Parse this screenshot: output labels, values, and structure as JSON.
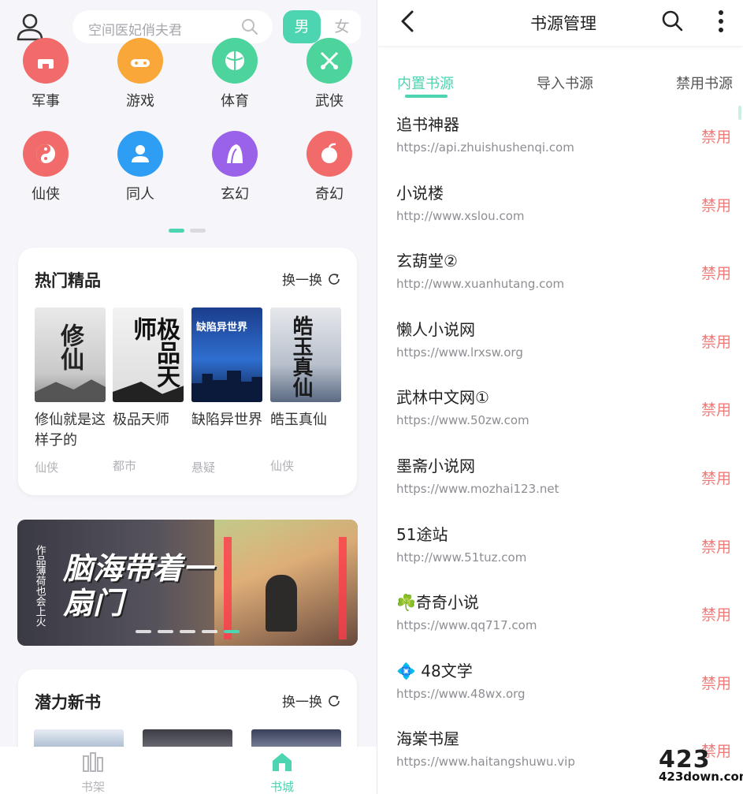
{
  "left": {
    "search": {
      "placeholder": "空间医妃俏夫君"
    },
    "gender": {
      "male": "男",
      "female": "女"
    },
    "categories_row1": [
      {
        "label": "军事",
        "color": "#f26b6b",
        "icon": "military-icon"
      },
      {
        "label": "游戏",
        "color": "#f8a738",
        "icon": "gamepad-icon"
      },
      {
        "label": "体育",
        "color": "#4dd49c",
        "icon": "basketball-icon"
      },
      {
        "label": "武侠",
        "color": "#4dd49c",
        "icon": "swords-icon"
      }
    ],
    "categories_row2": [
      {
        "label": "仙侠",
        "color": "#f26b6b",
        "icon": "taichi-icon"
      },
      {
        "label": "同人",
        "color": "#2e9ef4",
        "icon": "person-icon"
      },
      {
        "label": "玄幻",
        "color": "#9a62e8",
        "icon": "mountain-icon"
      },
      {
        "label": "奇幻",
        "color": "#f26b6b",
        "icon": "fruit-icon"
      }
    ],
    "hot": {
      "title": "热门精品",
      "refresh": "换一换",
      "books": [
        {
          "title": "修仙就是这样子的",
          "genre": "仙侠",
          "cover_text": "修仙"
        },
        {
          "title": "极品天师",
          "genre": "都市",
          "cover_text": "极品天师"
        },
        {
          "title": "缺陷异世界",
          "genre": "悬疑",
          "cover_text": "缺陷异世界"
        },
        {
          "title": "皓玉真仙",
          "genre": "仙侠",
          "cover_text": "皓玉真仙"
        }
      ]
    },
    "banner": {
      "title": "脑海带着一扇门",
      "tag": "作品",
      "author": "薄荷也会上火"
    },
    "potential": {
      "title": "潜力新书",
      "refresh": "换一换"
    },
    "nav": {
      "shelf": "书架",
      "store": "书城"
    }
  },
  "right": {
    "title": "书源管理",
    "tabs": [
      "内置书源",
      "导入书源",
      "禁用书源"
    ],
    "action_label": "禁用",
    "sources": [
      {
        "name": "追书神器",
        "url": "https://api.zhuishushenqi.com"
      },
      {
        "name": "小说楼",
        "url": "http://www.xslou.com"
      },
      {
        "name": "玄葫堂②",
        "url": "http://www.xuanhutang.com"
      },
      {
        "name": "懒人小说网",
        "url": "https://www.lrxsw.org"
      },
      {
        "name": "武林中文网①",
        "url": "https://www.50zw.com"
      },
      {
        "name": "墨斋小说网",
        "url": "https://www.mozhai123.net"
      },
      {
        "name": "51途站",
        "url": "http://www.51tuz.com"
      },
      {
        "name": "☘️奇奇小说",
        "url": "https://www.qq717.com"
      },
      {
        "name": "💠 48文学",
        "url": "https://www.48wx.org"
      },
      {
        "name": "海棠书屋",
        "url": "https://www.haitangshuwu.vip"
      }
    ]
  },
  "watermark": {
    "big": "423",
    "small": "423down.com"
  },
  "colors": {
    "accent": "#4dd4b0",
    "danger": "#f07c7a"
  }
}
